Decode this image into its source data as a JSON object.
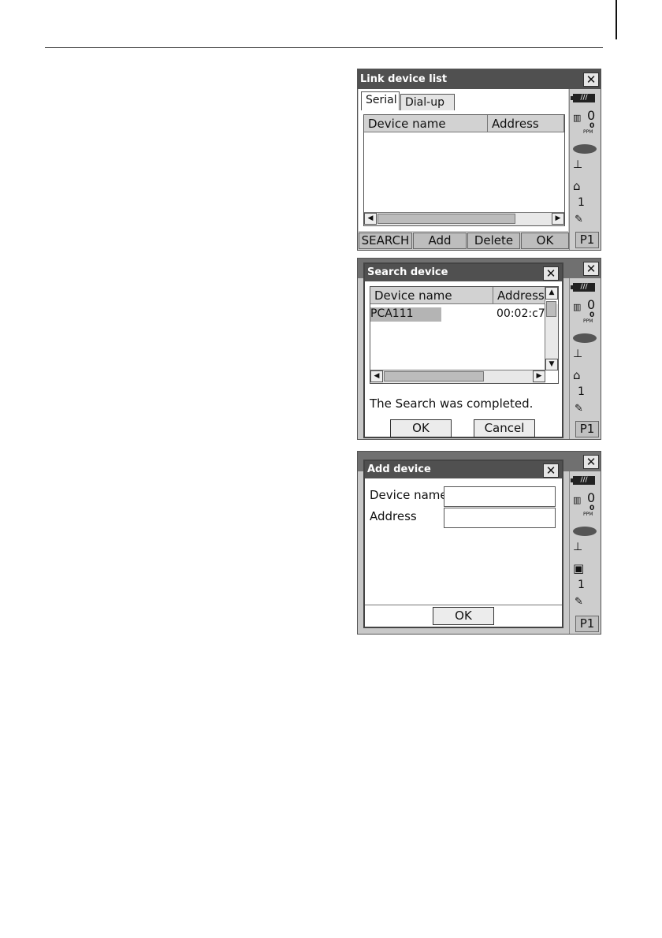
{
  "screen1": {
    "title": "Link device list",
    "tabs": [
      "Serial",
      "Dial-up"
    ],
    "columns": [
      "Device name",
      "Address"
    ],
    "softkeys": [
      "SEARCH",
      "Add",
      "Delete",
      "OK"
    ],
    "page": "P1"
  },
  "screen2": {
    "dialog_title": "Search device",
    "columns": [
      "Device name",
      "Address"
    ],
    "row": {
      "name": "PCA111",
      "address": "00:02:c7"
    },
    "message": "The Search was completed.",
    "ok": "OK",
    "cancel": "Cancel",
    "page": "P1"
  },
  "screen3": {
    "dialog_title": "Add device",
    "device_name_label": "Device name",
    "address_label": "Address",
    "ok": "OK",
    "page": "P1"
  },
  "status": {
    "battery": "///",
    "prism_constant": "0",
    "ppm_value": "0",
    "ppm_unit": "PPM",
    "page_number": "1"
  },
  "icons": {
    "close": "close-icon",
    "battery": "battery-icon",
    "prism": "prism-icon",
    "laser": "laser-icon",
    "tilt": "tilt-icon",
    "device": "device-icon",
    "input": "input-mode-icon"
  }
}
